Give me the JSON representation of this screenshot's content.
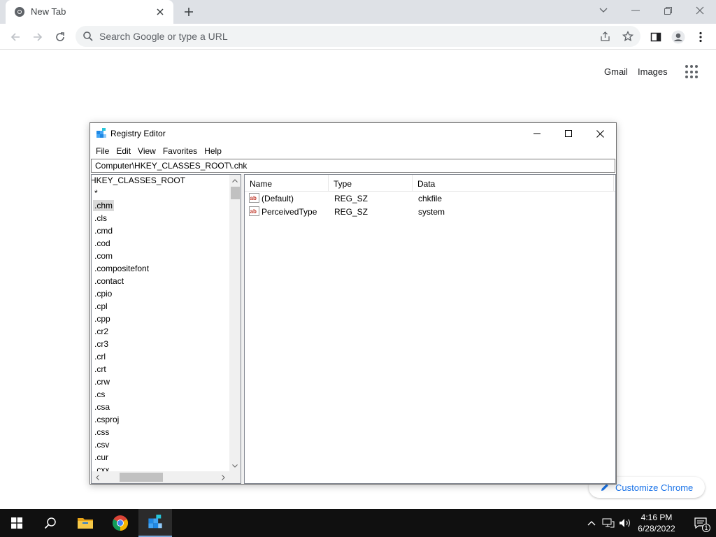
{
  "browser": {
    "tab": {
      "title": "New Tab"
    },
    "omnibox": {
      "placeholder": "Search Google or type a URL"
    },
    "ntp": {
      "gmail": "Gmail",
      "images": "Images"
    },
    "customize": {
      "label": "Customize Chrome"
    },
    "colors": {
      "tabstrip": "#dee1e6",
      "link_blue": "#1a73e8"
    }
  },
  "regedit": {
    "title": "Registry Editor",
    "menu": [
      "File",
      "Edit",
      "View",
      "Favorites",
      "Help"
    ],
    "address": "Computer\\HKEY_CLASSES_ROOT\\.chk",
    "tree": {
      "root": "HKEY_CLASSES_ROOT",
      "items": [
        ".chm",
        ".cls",
        ".cmd",
        ".cod",
        ".com",
        ".compositefont",
        ".contact",
        ".cpio",
        ".cpl",
        ".cpp",
        ".cr2",
        ".cr3",
        ".crl",
        ".crt",
        ".crw",
        ".cs",
        ".csa",
        ".csproj",
        ".css",
        ".csv",
        ".cur",
        ".cxx"
      ],
      "star": "*",
      "selected": ".chm"
    },
    "list": {
      "columns": [
        "Name",
        "Type",
        "Data"
      ],
      "rows": [
        {
          "name": "(Default)",
          "type": "REG_SZ",
          "data": "chkfile",
          "icon": "reg-sz-icon"
        },
        {
          "name": "PerceivedType",
          "type": "REG_SZ",
          "data": "system",
          "icon": "reg-sz-icon"
        }
      ]
    }
  },
  "taskbar": {
    "time": "4:16 PM",
    "date": "6/28/2022",
    "notifications": "1",
    "accent": "#7aa7d8"
  }
}
